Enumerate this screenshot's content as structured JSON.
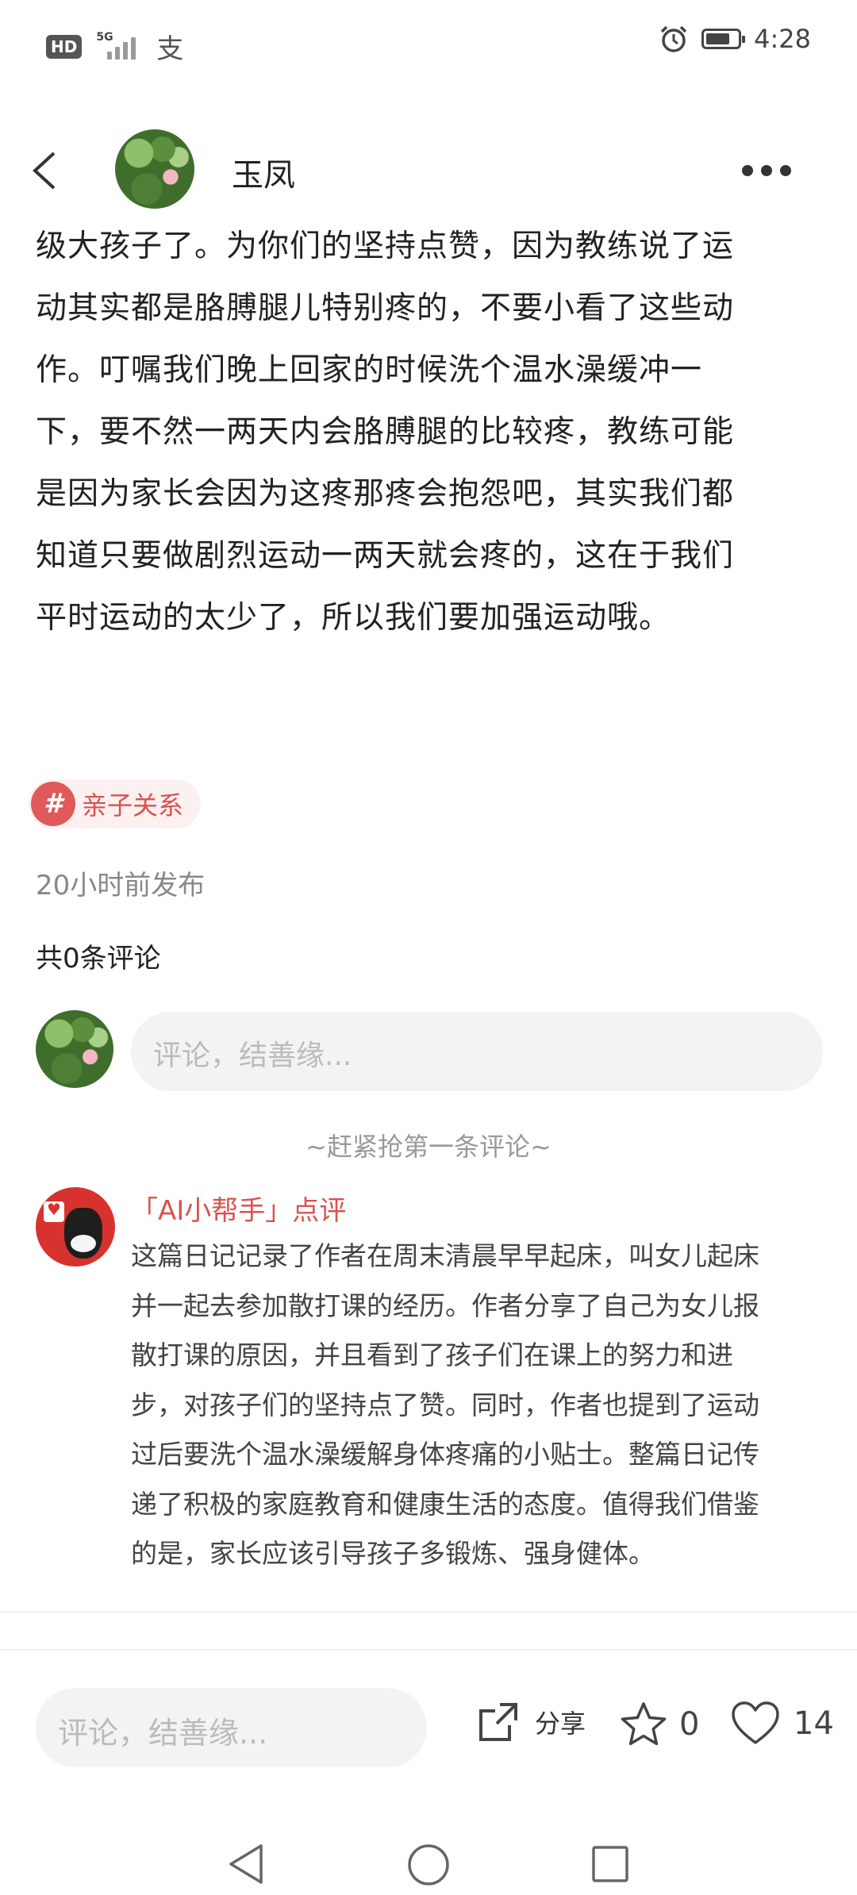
{
  "status_bar": {
    "hd": "HD",
    "network": "5G",
    "pay_icon": "支",
    "time": "4:28",
    "battery_level": 0.75
  },
  "header": {
    "author_name": "玉凤"
  },
  "article": {
    "lines": [
      "级大孩子了。为你们的坚持点赞，因为教练说了运",
      "动其实都是胳膊腿儿特别疼的，不要小看了这些动",
      "作。叮嘱我们晚上回家的时候洗个温水澡缓冲一",
      "下，要不然一两天内会胳膊腿的比较疼，教练可能",
      "是因为家长会因为这疼那疼会抱怨吧，其实我们都",
      "知道只要做剧烈运动一两天就会疼的，这在于我们",
      "平时运动的太少了，所以我们要加强运动哦。"
    ]
  },
  "tag": {
    "hash": "#",
    "label": "亲子关系"
  },
  "meta": {
    "publish_time": "20小时前发布",
    "comment_count": "共0条评论"
  },
  "comment_box": {
    "placeholder": "评论，结善缘..."
  },
  "first_comment_tip": "~赶紧抢第一条评论~",
  "ai_review": {
    "title": "「AI小帮手」点评",
    "lines": [
      "这篇日记记录了作者在周末清晨早早起床，叫女儿起床",
      "并一起去参加散打课的经历。作者分享了自己为女儿报",
      "散打课的原因，并且看到了孩子们在课上的努力和进",
      "步，对孩子们的坚持点了赞。同时，作者也提到了运动",
      "过后要洗个温水澡缓解身体疼痛的小贴士。整篇日记传",
      "递了积极的家庭教育和健康生活的态度。值得我们借鉴",
      "的是，家长应该引导孩子多锻炼、强身健体。"
    ]
  },
  "bottom_bar": {
    "input_placeholder": "评论，结善缘...",
    "share_label": "分享",
    "favorite_count": "0",
    "like_count": "14"
  }
}
